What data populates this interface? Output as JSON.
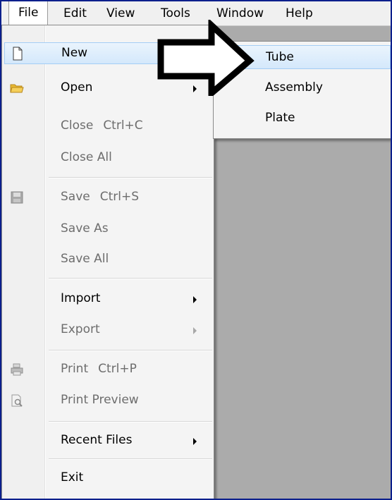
{
  "menubar": {
    "items": [
      {
        "label": "File"
      },
      {
        "label": "Edit"
      },
      {
        "label": "View"
      },
      {
        "label": "Tools"
      },
      {
        "label": "Window"
      },
      {
        "label": "Help"
      }
    ]
  },
  "file_menu": {
    "new_label": "New",
    "open_label": "Open",
    "close_label": "Close",
    "close_shortcut": "Ctrl+C",
    "close_all_label": "Close All",
    "save_label": "Save",
    "save_shortcut": "Ctrl+S",
    "save_as_label": "Save As",
    "save_all_label": "Save All",
    "import_label": "Import",
    "export_label": "Export",
    "print_label": "Print",
    "print_shortcut": "Ctrl+P",
    "print_preview_label": "Print Preview",
    "recent_files_label": "Recent Files",
    "exit_label": "Exit"
  },
  "new_submenu": {
    "items": [
      {
        "label": "Tube"
      },
      {
        "label": "Assembly"
      },
      {
        "label": "Plate"
      }
    ]
  },
  "colors": {
    "highlight": "#d4e8fb",
    "disabled_text": "#6d6d6d",
    "workspace": "#ababab",
    "frame_border": "#0b1f8c"
  }
}
